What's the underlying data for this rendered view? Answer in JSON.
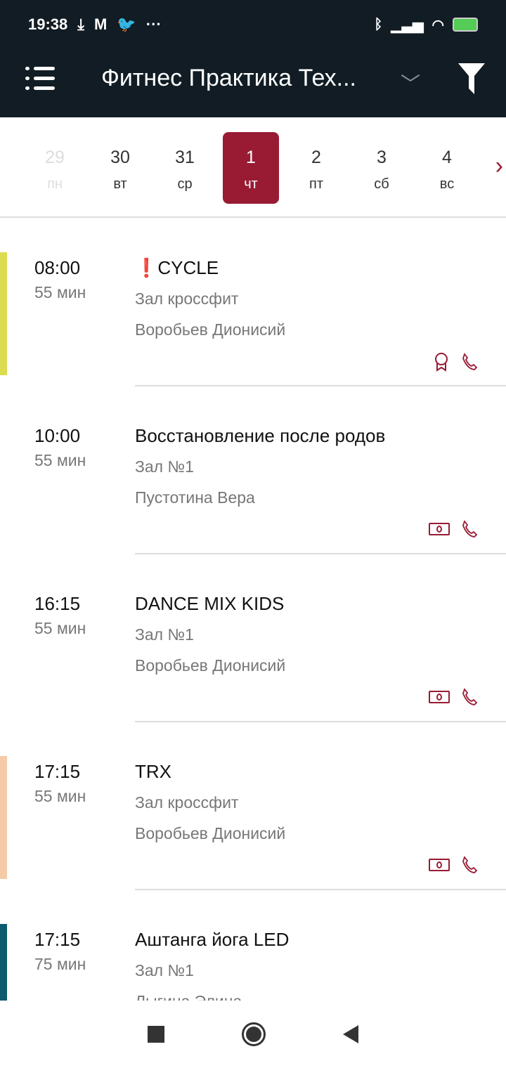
{
  "status": {
    "time": "19:38",
    "icons": [
      "download-icon",
      "gmail-icon",
      "twitter-icon",
      "more-icon"
    ],
    "right_icons": [
      "bluetooth-icon",
      "signal-icon",
      "wifi-icon",
      "battery-charging-icon"
    ]
  },
  "appbar": {
    "title": "Фитнес Практика Тех...",
    "icons": [
      "menu-icon",
      "chevron-down-icon",
      "filter-icon"
    ]
  },
  "accent": "#981b33",
  "dates": [
    {
      "num": "29",
      "day": "пн",
      "state": "disabled"
    },
    {
      "num": "30",
      "day": "вт"
    },
    {
      "num": "31",
      "day": "ср"
    },
    {
      "num": "1",
      "day": "чт",
      "state": "selected"
    },
    {
      "num": "2",
      "day": "пт"
    },
    {
      "num": "3",
      "day": "сб"
    },
    {
      "num": "4",
      "day": "вс"
    }
  ],
  "classes": [
    {
      "time": "08:00",
      "duration": "55 мин",
      "alert": "❗",
      "name": "CYCLE",
      "hall": "Зал кроссфит",
      "coach": "Воробьев Дионисий",
      "color": "#dcdc50",
      "icons": [
        "award-icon",
        "phone-icon"
      ]
    },
    {
      "time": "10:00",
      "duration": "55 мин",
      "name": "Восстановление после родов",
      "hall": "Зал №1",
      "coach": "Пустотина Вера",
      "color": "",
      "icons": [
        "money-icon",
        "phone-icon"
      ]
    },
    {
      "time": "16:15",
      "duration": "55 мин",
      "name": "DANCE MIX KIDS",
      "hall": "Зал №1",
      "coach": "Воробьев Дионисий",
      "color": "",
      "icons": [
        "money-icon",
        "phone-icon"
      ]
    },
    {
      "time": "17:15",
      "duration": "55 мин",
      "name": "TRX",
      "hall": "Зал кроссфит",
      "coach": "Воробьев Дионисий",
      "color": "#f5cba7",
      "icons": [
        "money-icon",
        "phone-icon"
      ]
    },
    {
      "time": "17:15",
      "duration": "75 мин",
      "name": "Аштанга йога LED",
      "hall": "Зал №1",
      "coach": "Лыгина Элина",
      "color": "#0e5a6e",
      "icons": []
    }
  ]
}
